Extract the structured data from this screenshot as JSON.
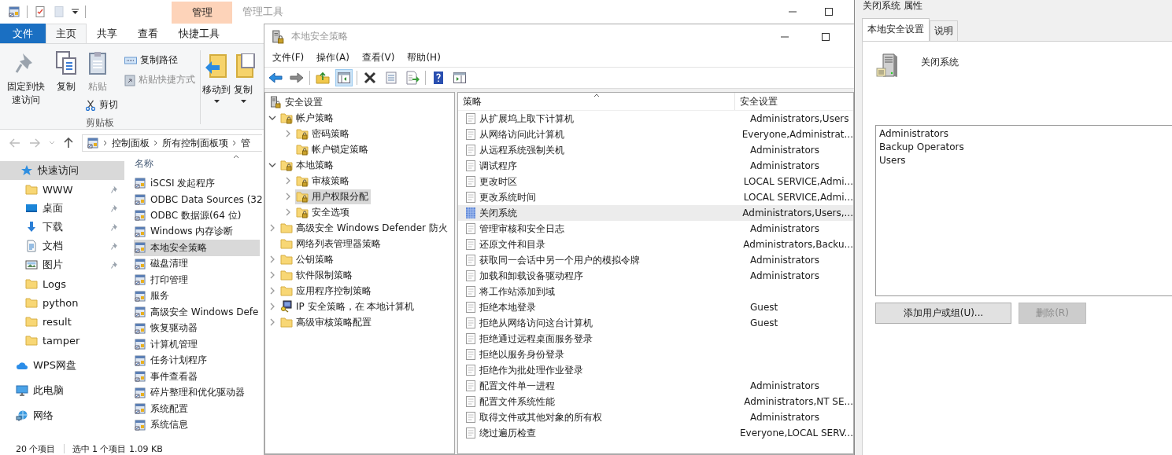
{
  "explorer": {
    "contextual_group": "管理",
    "title": "管理工具",
    "ribbon_tabs": [
      {
        "label": "文件",
        "kind": "file",
        "selected": false
      },
      {
        "label": "主页",
        "kind": "normal",
        "selected": true
      },
      {
        "label": "共享",
        "kind": "normal",
        "selected": false
      },
      {
        "label": "查看",
        "kind": "normal",
        "selected": false
      },
      {
        "label": "快捷工具",
        "kind": "contextual",
        "selected": false
      }
    ],
    "clipboard": {
      "label": "剪贴板",
      "pin": {
        "label": "固定到快速访问",
        "disabled": false
      },
      "copy": {
        "label": "复制",
        "disabled": false
      },
      "paste": {
        "label": "粘贴",
        "disabled": true
      },
      "cut": {
        "label": "剪切",
        "disabled": false
      },
      "copy_path": {
        "label": "复制路径",
        "disabled": false
      },
      "paste_shortcut": {
        "label": "粘贴快捷方式",
        "disabled": true
      }
    },
    "organize": [
      {
        "label": "移动到",
        "kind": "move"
      },
      {
        "label": "复制",
        "kind": "copy"
      }
    ],
    "address": [
      "控制面板",
      "所有控制面板项",
      "管"
    ],
    "nav": [
      {
        "label": "快速访问",
        "kind": "star",
        "selected": true,
        "pinned": false,
        "children": [
          {
            "label": "WWW",
            "kind": "folder",
            "selected": false,
            "pinned": true
          },
          {
            "label": "桌面",
            "kind": "desktop",
            "selected": false,
            "pinned": true
          },
          {
            "label": "下载",
            "kind": "download",
            "selected": false,
            "pinned": true
          },
          {
            "label": "文档",
            "kind": "document",
            "selected": false,
            "pinned": true
          },
          {
            "label": "图片",
            "kind": "picture",
            "selected": false,
            "pinned": true
          },
          {
            "label": "Logs",
            "kind": "folder",
            "selected": false,
            "pinned": false
          },
          {
            "label": "python",
            "kind": "folder",
            "selected": false,
            "pinned": false
          },
          {
            "label": "result",
            "kind": "folder",
            "selected": false,
            "pinned": false
          },
          {
            "label": "tamper",
            "kind": "folder",
            "selected": false,
            "pinned": false
          }
        ]
      },
      {
        "label": "WPS网盘",
        "kind": "cloud",
        "selected": false,
        "pinned": false
      },
      {
        "label": "此电脑",
        "kind": "computer",
        "selected": false,
        "pinned": false
      },
      {
        "label": "网络",
        "kind": "network",
        "selected": false,
        "pinned": false
      }
    ],
    "column": "名称",
    "files": [
      {
        "label": "iSCSI 发起程序",
        "selected": false
      },
      {
        "label": "ODBC Data Sources (32",
        "selected": false
      },
      {
        "label": "ODBC 数据源(64 位)",
        "selected": false
      },
      {
        "label": "Windows 内存诊断",
        "selected": false
      },
      {
        "label": "本地安全策略",
        "selected": true
      },
      {
        "label": "磁盘清理",
        "selected": false
      },
      {
        "label": "打印管理",
        "selected": false
      },
      {
        "label": "服务",
        "selected": false
      },
      {
        "label": "高级安全 Windows Defe",
        "selected": false
      },
      {
        "label": "恢复驱动器",
        "selected": false
      },
      {
        "label": "计算机管理",
        "selected": false
      },
      {
        "label": "任务计划程序",
        "selected": false
      },
      {
        "label": "事件查看器",
        "selected": false
      },
      {
        "label": "碎片整理和优化驱动器",
        "selected": false
      },
      {
        "label": "系统配置",
        "selected": false
      },
      {
        "label": "系统信息",
        "selected": false
      }
    ],
    "status": [
      "20 个项目",
      "选中 1 个项目  1.09 KB"
    ]
  },
  "policy_window": {
    "title": "本地安全策略",
    "menu": [
      "文件(F)",
      "操作(A)",
      "查看(V)",
      "帮助(H)"
    ],
    "tree_toggle_pressed": true,
    "tree": [
      {
        "label": "安全设置",
        "kind": "root",
        "selected": false,
        "children": [
          {
            "label": "帐户策略",
            "kind": "lock_folder",
            "expandable": true,
            "expanded": true,
            "selected": false,
            "children": [
              {
                "label": "密码策略",
                "kind": "lock_folder",
                "expandable": true,
                "expanded": false,
                "selected": false
              },
              {
                "label": "帐户锁定策略",
                "kind": "lock_folder",
                "expandable": false,
                "selected": false
              }
            ]
          },
          {
            "label": "本地策略",
            "kind": "lock_folder",
            "expandable": true,
            "expanded": true,
            "selected": false,
            "children": [
              {
                "label": "审核策略",
                "kind": "lock_folder",
                "expandable": true,
                "expanded": false,
                "selected": false
              },
              {
                "label": "用户权限分配",
                "kind": "lock_folder",
                "expandable": true,
                "expanded": false,
                "selected": true
              },
              {
                "label": "安全选项",
                "kind": "lock_folder",
                "expandable": true,
                "expanded": false,
                "selected": false
              }
            ]
          },
          {
            "label": "高级安全 Windows Defender 防火",
            "kind": "folder",
            "expandable": true,
            "expanded": false,
            "selected": false
          },
          {
            "label": "网络列表管理器策略",
            "kind": "folder",
            "expandable": false,
            "selected": false
          },
          {
            "label": "公钥策略",
            "kind": "folder",
            "expandable": true,
            "expanded": false,
            "selected": false
          },
          {
            "label": "软件限制策略",
            "kind": "folder",
            "expandable": true,
            "expanded": false,
            "selected": false
          },
          {
            "label": "应用程序控制策略",
            "kind": "folder",
            "expandable": true,
            "expanded": false,
            "selected": false
          },
          {
            "label": "IP 安全策略，在 本地计算机",
            "kind": "ip",
            "expandable": true,
            "expanded": false,
            "selected": false
          },
          {
            "label": "高级审核策略配置",
            "kind": "folder",
            "expandable": true,
            "expanded": false,
            "selected": false
          }
        ]
      }
    ],
    "columns": [
      "策略",
      "安全设置"
    ],
    "rows": [
      {
        "policy": "从扩展坞上取下计算机",
        "setting": "Administrators,Users",
        "selected": false
      },
      {
        "policy": "从网络访问此计算机",
        "setting": "Everyone,Administrat...",
        "selected": false
      },
      {
        "policy": "从远程系统强制关机",
        "setting": "Administrators",
        "selected": false
      },
      {
        "policy": "调试程序",
        "setting": "Administrators",
        "selected": false
      },
      {
        "policy": "更改时区",
        "setting": "LOCAL SERVICE,Admi...",
        "selected": false
      },
      {
        "policy": "更改系统时间",
        "setting": "LOCAL SERVICE,Admi...",
        "selected": false
      },
      {
        "policy": "关闭系统",
        "setting": "Administrators,Users,...",
        "selected": true
      },
      {
        "policy": "管理审核和安全日志",
        "setting": "Administrators",
        "selected": false
      },
      {
        "policy": "还原文件和目录",
        "setting": "Administrators,Backu...",
        "selected": false
      },
      {
        "policy": "获取同一会话中另一个用户的模拟令牌",
        "setting": "Administrators",
        "selected": false
      },
      {
        "policy": "加载和卸载设备驱动程序",
        "setting": "Administrators",
        "selected": false
      },
      {
        "policy": "将工作站添加到域",
        "selected": false
      },
      {
        "policy": "拒绝本地登录",
        "setting": "Guest",
        "selected": false
      },
      {
        "policy": "拒绝从网络访问这台计算机",
        "setting": "Guest",
        "selected": false
      },
      {
        "policy": "拒绝通过远程桌面服务登录",
        "selected": false
      },
      {
        "policy": "拒绝以服务身份登录",
        "selected": false
      },
      {
        "policy": "拒绝作为批处理作业登录",
        "selected": false
      },
      {
        "policy": "配置文件单一进程",
        "setting": "Administrators",
        "selected": false
      },
      {
        "policy": "配置文件系统性能",
        "setting": "Administrators,NT SE...",
        "selected": false
      },
      {
        "policy": "取得文件或其他对象的所有权",
        "setting": "Administrators",
        "selected": false
      },
      {
        "policy": "绕过遍历检查",
        "setting": "Everyone,LOCAL SERV...",
        "selected": false
      }
    ]
  },
  "dialog": {
    "title": "关闭系统 属性",
    "tabs": [
      {
        "label": "本地安全设置",
        "selected": true
      },
      {
        "label": "说明",
        "selected": false
      }
    ],
    "policy": "关闭系统",
    "members": [
      "Administrators",
      "Backup Operators",
      "Users"
    ],
    "buttons": [
      {
        "label": "添加用户或组(U)...",
        "disabled": false
      },
      {
        "label": "删除(R)",
        "disabled": true
      }
    ]
  }
}
